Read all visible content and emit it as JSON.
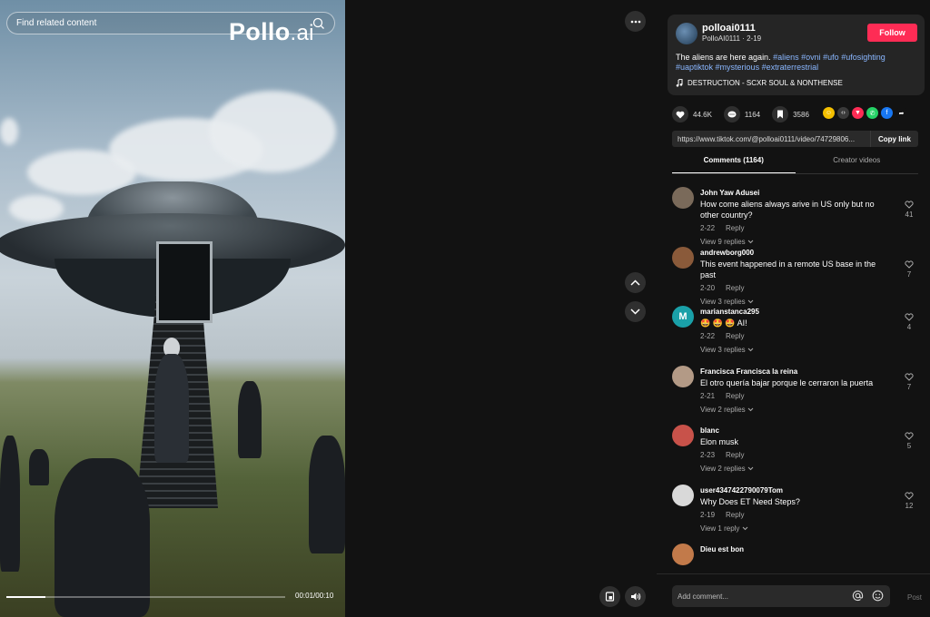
{
  "video": {
    "search_placeholder": "Find related content",
    "logo_main": "Pollo",
    "logo_suffix": ".ai",
    "time": "00:01/00:10",
    "progress_fraction": 0.14
  },
  "author": {
    "username": "polloai0111",
    "handle": "PolloAI0111",
    "date": "2-19",
    "follow_label": "Follow"
  },
  "description": {
    "text": "The aliens are here again.",
    "tags": [
      "#aliens",
      "#ovni",
      "#ufo",
      "#ufosighting",
      "#uaptiktok",
      "#mysterious",
      "#extraterrestrial"
    ]
  },
  "music": "DESTRUCTION - SCXR SOUL & NONTHENSE",
  "stats": {
    "likes": "44.6K",
    "comments": "1164",
    "saves": "3586"
  },
  "share": {
    "icons": [
      "embed-icon",
      "code-icon",
      "send-icon",
      "whatsapp-icon",
      "facebook-icon",
      "share-arrow-icon"
    ],
    "colors": [
      "#f5c000",
      "#3a3a3a",
      "#fe2c55",
      "#25d366",
      "#1877f2",
      "#121212"
    ]
  },
  "link": {
    "url": "https://www.tiktok.com/@polloai0111/video/74729806...",
    "copy_label": "Copy link"
  },
  "tabs": [
    {
      "label": "Comments (1164)",
      "active": true
    },
    {
      "label": "Creator videos",
      "active": false
    }
  ],
  "comments": [
    {
      "user": "John Yaw Adusei",
      "text": "How come aliens always arive in US only but no other country?",
      "date": "2-22",
      "reply": "Reply",
      "view": "View 9 replies",
      "likes": "41",
      "avatar_color": "#7a6a5a",
      "initial": ""
    },
    {
      "user": "andrewborg000",
      "text": "This event happened in a remote US base in the past",
      "date": "2-20",
      "reply": "Reply",
      "view": "View 3 replies",
      "likes": "7",
      "avatar_color": "#8a5a3a",
      "initial": ""
    },
    {
      "user": "marianstanca295",
      "text": "🤩 🤩 🤩 AI!",
      "date": "2-22",
      "reply": "Reply",
      "view": "View 3 replies",
      "likes": "4",
      "avatar_color": "#1aa0a8",
      "initial": "M"
    },
    {
      "user": "Francisca Francisca la reina",
      "text": "El otro quería bajar porque le cerraron la puerta",
      "date": "2-21",
      "reply": "Reply",
      "view": "View 2 replies",
      "likes": "7",
      "avatar_color": "#b39a86",
      "initial": ""
    },
    {
      "user": "blanc",
      "text": "Elon musk",
      "date": "2-23",
      "reply": "Reply",
      "view": "View 2 replies",
      "likes": "5",
      "avatar_color": "#c8524a",
      "initial": ""
    },
    {
      "user": "user4347422790079Tom",
      "text": "Why Does ET Need Steps?",
      "date": "2-19",
      "reply": "Reply",
      "view": "View 1 reply",
      "likes": "12",
      "avatar_color": "#d9d9d9",
      "initial": ""
    },
    {
      "user": "Dieu est bon",
      "text": "",
      "date": "",
      "reply": "",
      "view": "",
      "likes": "",
      "avatar_color": "#c27a4a",
      "initial": ""
    }
  ],
  "composer": {
    "placeholder": "Add comment...",
    "post_label": "Post"
  }
}
